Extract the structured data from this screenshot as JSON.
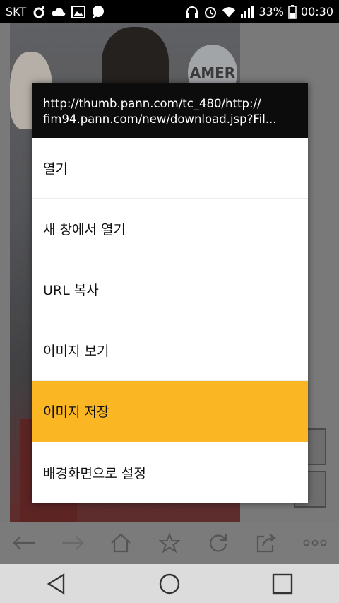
{
  "status_bar": {
    "carrier": "SKT",
    "battery": "33%",
    "time": "00:30"
  },
  "dialog": {
    "url_line1": "http://thumb.pann.com/tc_480/http://",
    "url_line2": "fim94.pann.com/new/download.jsp?Fil...",
    "items": [
      {
        "label": "열기"
      },
      {
        "label": "새 창에서 열기"
      },
      {
        "label": "URL 복사"
      },
      {
        "label": "이미지 보기"
      },
      {
        "label": "이미지 저장",
        "selected": true
      },
      {
        "label": "배경화면으로 설정"
      }
    ]
  },
  "background": {
    "sign_text": "AMER"
  },
  "colors": {
    "selected_item": "#fbb623",
    "dialog_header": "#0c0c0c"
  },
  "toolbar": {
    "icons": [
      "back-arrow-icon",
      "forward-arrow-icon",
      "home-icon",
      "star-icon",
      "refresh-icon",
      "share-icon",
      "more-icon"
    ]
  },
  "navbar": {
    "icons": [
      "back-triangle-icon",
      "home-circle-icon",
      "recents-square-icon"
    ]
  }
}
